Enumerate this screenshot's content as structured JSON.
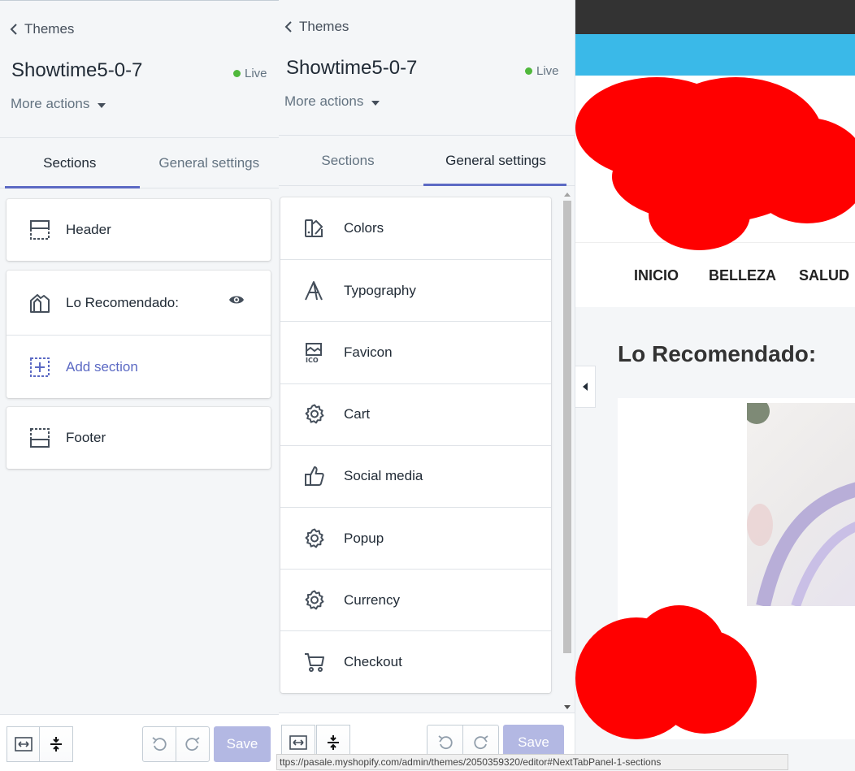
{
  "panel_left": {
    "back_label": "Themes",
    "theme_name": "Showtime5-0-7",
    "live_label": "Live",
    "more_actions": "More actions",
    "tabs": [
      "Sections",
      "General settings"
    ],
    "active_tab": "Sections",
    "sections": {
      "header": "Header",
      "recommended": "Lo Recomendado:",
      "add_section": "Add section",
      "footer": "Footer"
    },
    "save_label": "Save"
  },
  "panel_right": {
    "back_label": "Themes",
    "theme_name": "Showtime5-0-7",
    "live_label": "Live",
    "more_actions": "More actions",
    "tabs": [
      "Sections",
      "General settings"
    ],
    "active_tab": "General settings",
    "settings": [
      {
        "label": "Colors",
        "icon": "colors-icon"
      },
      {
        "label": "Typography",
        "icon": "typography-icon"
      },
      {
        "label": "Favicon",
        "icon": "favicon-icon"
      },
      {
        "label": "Cart",
        "icon": "gear-icon"
      },
      {
        "label": "Social media",
        "icon": "thumbs-up-icon"
      },
      {
        "label": "Popup",
        "icon": "gear-icon"
      },
      {
        "label": "Currency",
        "icon": "gear-icon"
      },
      {
        "label": "Checkout",
        "icon": "cart-icon"
      }
    ],
    "save_label": "Save"
  },
  "preview": {
    "nav": [
      "INICIO",
      "BELLEZA",
      "SALUD"
    ],
    "section_title": "Lo Recomendado:"
  },
  "status_url": "ttps://pasale.myshopify.com/admin/themes/2050359320/editor#NextTabPanel-1-sections",
  "colors": {
    "accent": "#5c6ac4",
    "live_dot": "#50b83c",
    "save_disabled": "#b3b8e3",
    "preview_bar": "#3ab9e8",
    "redaction": "#ff0000"
  }
}
